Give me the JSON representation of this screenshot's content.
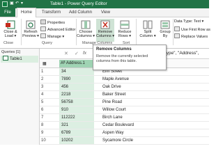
{
  "titlebar": {
    "title": "Table1 - Power Query Editor",
    "bg_color": "#217346"
  },
  "tabs": [
    "File",
    "Home",
    "Transform",
    "Add Column",
    "View"
  ],
  "ribbon": {
    "close_load": [
      "Close &",
      "Load ▾"
    ],
    "refresh_preview": [
      "Refresh",
      "Preview ▾"
    ],
    "properties": "Properties",
    "advanced_editor": "Advanced Editor",
    "manage": "Manage ▾",
    "choose_columns": [
      "Choose",
      "Columns ▾"
    ],
    "remove_columns": [
      "Remove",
      "Columns ▾"
    ],
    "reduce_rows": [
      "Reduce",
      "Rows ▾"
    ],
    "split_column": [
      "Split",
      "Column ▾"
    ],
    "group_by": [
      "Group",
      "By"
    ],
    "data_type": "Data Type: Text ▾",
    "use_first_row": "Use First Row as",
    "replace_values": "Replace Values",
    "groups": {
      "close": "Close",
      "query": "Query",
      "manage_columns": "Manage Columns",
      "sort": "Sort"
    }
  },
  "queries": {
    "header": "Queries [1]",
    "items": [
      "Table1"
    ]
  },
  "formula_bar": {
    "fx": "fx",
    "visible_text": "Type\", \"Address\","
  },
  "column_header": {
    "type_icon": "Aᴮ",
    "label": "Address.1"
  },
  "tooltip": {
    "title": "Remove Columns",
    "description": "Remove the currently selected columns from this table."
  },
  "rows": [
    {
      "n": "1",
      "a": "34",
      "b": "Elm Street"
    },
    {
      "n": "2",
      "a": "7890",
      "b": "Maple Avenue"
    },
    {
      "n": "3",
      "a": "456",
      "b": "Oak Drive"
    },
    {
      "n": "4",
      "a": "2218",
      "b": "Baker Street"
    },
    {
      "n": "5",
      "a": "56758",
      "b": "Pine Road"
    },
    {
      "n": "6",
      "a": "910",
      "b": "Willow Court"
    },
    {
      "n": "7",
      "a": "112222",
      "b": "Birch Lane"
    },
    {
      "n": "8",
      "a": "321",
      "b": "Cedar Boulevard"
    },
    {
      "n": "9",
      "a": "6789",
      "b": "Aspen Way"
    },
    {
      "n": "10",
      "a": "10202",
      "b": "Sycamore Circle"
    }
  ]
}
